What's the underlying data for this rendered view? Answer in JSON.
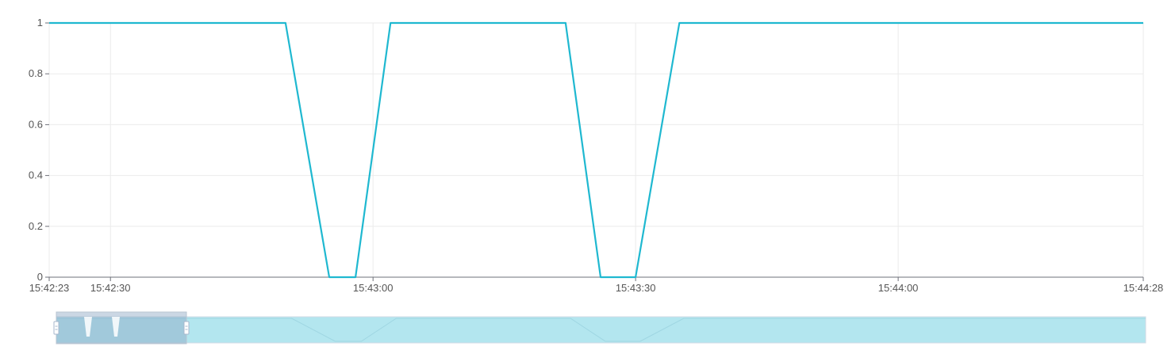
{
  "chart_data": {
    "type": "line",
    "title": "",
    "xlabel": "",
    "ylabel": "",
    "x_axis": {
      "type": "time",
      "range": [
        "15:42:23",
        "15:44:28"
      ],
      "tick_labels": [
        "15:42:23",
        "15:42:30",
        "15:43:00",
        "15:43:30",
        "15:44:00",
        "15:44:28"
      ]
    },
    "y_axis": {
      "range": [
        0,
        1
      ],
      "tick_labels": [
        "0",
        "0.2",
        "0.4",
        "0.6",
        "0.8",
        "1"
      ]
    },
    "grid": true,
    "legend": "none",
    "series": [
      {
        "color": "#1fb8d0",
        "x": [
          "15:42:23",
          "15:42:50",
          "15:42:55",
          "15:42:58",
          "15:43:02",
          "15:43:22",
          "15:43:26",
          "15:43:30",
          "15:43:35",
          "15:44:28"
        ],
        "y": [
          1,
          1,
          0,
          0,
          1,
          1,
          0,
          0,
          1,
          1
        ]
      }
    ],
    "data_zoom": {
      "window_start": "15:42:23",
      "window_end": "15:42:38"
    }
  }
}
